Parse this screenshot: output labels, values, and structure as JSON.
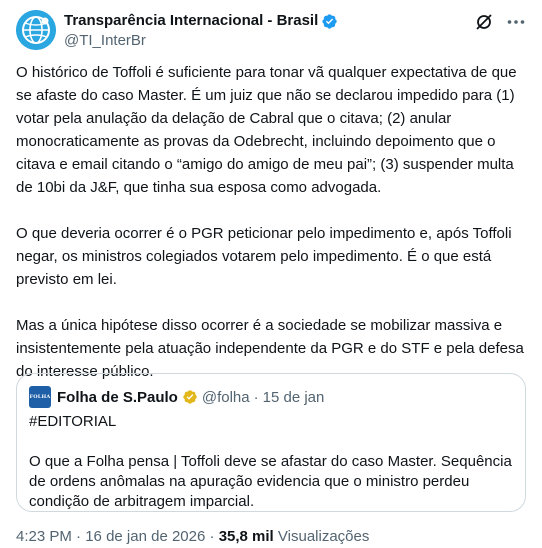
{
  "author": {
    "display_name": "Transparência Internacional - Brasil",
    "handle": "@TI_InterBr",
    "avatar_icon": "globe-person-logo",
    "badge_color": "#1d9bf0"
  },
  "tweet": {
    "paragraphs": [
      "O histórico de Toffoli é suficiente para tonar vã qualquer expectativa de que se afaste do caso Master. É um juiz que não se declarou impedido para (1) votar pela anulação da delação de Cabral que o citava; (2) anular monocraticamente as provas da Odebrecht, incluindo depoimento que o citava e email citando o “amigo do amigo de meu pai”; (3) suspender multa de 10bi da J&F, que tinha sua esposa como advogada.",
      "O que deveria ocorrer é o PGR peticionar pelo impedimento e, após Toffoli negar, os ministros colegiados votarem pelo impedimento. É o que está previsto em lei.",
      "Mas a única hipótese disso ocorrer é a sociedade se mobilizar massiva e insistentemente pela atuação independente da PGR e do STF e pela defesa do interesse público."
    ]
  },
  "quote": {
    "logo_text": "FOLHA",
    "name": "Folha de S.Paulo",
    "handle": "@folha",
    "separator": "·",
    "date": "15 de jan",
    "hashtag": "#EDITORIAL",
    "text": "O que a Folha pensa | Toffoli deve se afastar do caso Master. Sequência de ordens anômalas na apuração evidencia que o ministro perdeu condição de arbitragem imparcial.",
    "badge_color": "#e2b719"
  },
  "footer": {
    "time": "4:23 PM",
    "separator": "·",
    "date": "16 de jan de 2026",
    "views_count": "35,8 mil",
    "views_label": "Visualizações"
  },
  "colors": {
    "text": "#0f1419",
    "secondary": "#536471",
    "border": "#cfd9de",
    "avatar_bg": "#2aa6e0"
  }
}
